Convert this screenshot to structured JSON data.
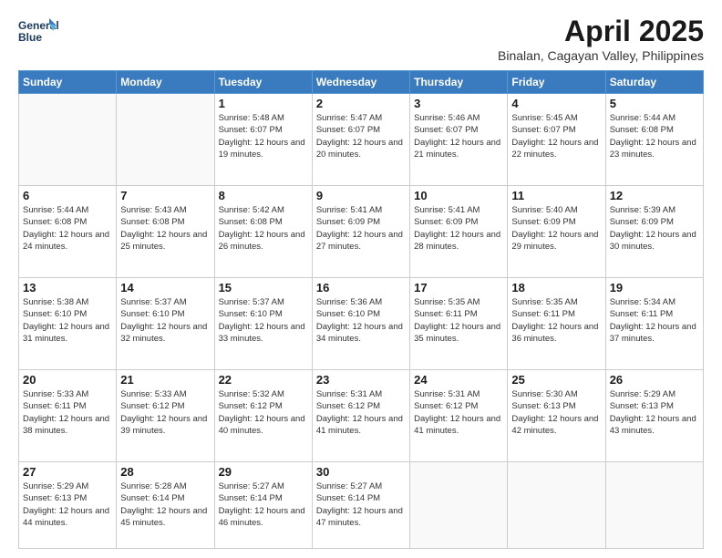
{
  "logo": {
    "line1": "General",
    "line2": "Blue"
  },
  "title": "April 2025",
  "subtitle": "Binalan, Cagayan Valley, Philippines",
  "days_of_week": [
    "Sunday",
    "Monday",
    "Tuesday",
    "Wednesday",
    "Thursday",
    "Friday",
    "Saturday"
  ],
  "weeks": [
    [
      {
        "day": "",
        "info": ""
      },
      {
        "day": "",
        "info": ""
      },
      {
        "day": "1",
        "sunrise": "Sunrise: 5:48 AM",
        "sunset": "Sunset: 6:07 PM",
        "daylight": "Daylight: 12 hours and 19 minutes."
      },
      {
        "day": "2",
        "sunrise": "Sunrise: 5:47 AM",
        "sunset": "Sunset: 6:07 PM",
        "daylight": "Daylight: 12 hours and 20 minutes."
      },
      {
        "day": "3",
        "sunrise": "Sunrise: 5:46 AM",
        "sunset": "Sunset: 6:07 PM",
        "daylight": "Daylight: 12 hours and 21 minutes."
      },
      {
        "day": "4",
        "sunrise": "Sunrise: 5:45 AM",
        "sunset": "Sunset: 6:07 PM",
        "daylight": "Daylight: 12 hours and 22 minutes."
      },
      {
        "day": "5",
        "sunrise": "Sunrise: 5:44 AM",
        "sunset": "Sunset: 6:08 PM",
        "daylight": "Daylight: 12 hours and 23 minutes."
      }
    ],
    [
      {
        "day": "6",
        "sunrise": "Sunrise: 5:44 AM",
        "sunset": "Sunset: 6:08 PM",
        "daylight": "Daylight: 12 hours and 24 minutes."
      },
      {
        "day": "7",
        "sunrise": "Sunrise: 5:43 AM",
        "sunset": "Sunset: 6:08 PM",
        "daylight": "Daylight: 12 hours and 25 minutes."
      },
      {
        "day": "8",
        "sunrise": "Sunrise: 5:42 AM",
        "sunset": "Sunset: 6:08 PM",
        "daylight": "Daylight: 12 hours and 26 minutes."
      },
      {
        "day": "9",
        "sunrise": "Sunrise: 5:41 AM",
        "sunset": "Sunset: 6:09 PM",
        "daylight": "Daylight: 12 hours and 27 minutes."
      },
      {
        "day": "10",
        "sunrise": "Sunrise: 5:41 AM",
        "sunset": "Sunset: 6:09 PM",
        "daylight": "Daylight: 12 hours and 28 minutes."
      },
      {
        "day": "11",
        "sunrise": "Sunrise: 5:40 AM",
        "sunset": "Sunset: 6:09 PM",
        "daylight": "Daylight: 12 hours and 29 minutes."
      },
      {
        "day": "12",
        "sunrise": "Sunrise: 5:39 AM",
        "sunset": "Sunset: 6:09 PM",
        "daylight": "Daylight: 12 hours and 30 minutes."
      }
    ],
    [
      {
        "day": "13",
        "sunrise": "Sunrise: 5:38 AM",
        "sunset": "Sunset: 6:10 PM",
        "daylight": "Daylight: 12 hours and 31 minutes."
      },
      {
        "day": "14",
        "sunrise": "Sunrise: 5:37 AM",
        "sunset": "Sunset: 6:10 PM",
        "daylight": "Daylight: 12 hours and 32 minutes."
      },
      {
        "day": "15",
        "sunrise": "Sunrise: 5:37 AM",
        "sunset": "Sunset: 6:10 PM",
        "daylight": "Daylight: 12 hours and 33 minutes."
      },
      {
        "day": "16",
        "sunrise": "Sunrise: 5:36 AM",
        "sunset": "Sunset: 6:10 PM",
        "daylight": "Daylight: 12 hours and 34 minutes."
      },
      {
        "day": "17",
        "sunrise": "Sunrise: 5:35 AM",
        "sunset": "Sunset: 6:11 PM",
        "daylight": "Daylight: 12 hours and 35 minutes."
      },
      {
        "day": "18",
        "sunrise": "Sunrise: 5:35 AM",
        "sunset": "Sunset: 6:11 PM",
        "daylight": "Daylight: 12 hours and 36 minutes."
      },
      {
        "day": "19",
        "sunrise": "Sunrise: 5:34 AM",
        "sunset": "Sunset: 6:11 PM",
        "daylight": "Daylight: 12 hours and 37 minutes."
      }
    ],
    [
      {
        "day": "20",
        "sunrise": "Sunrise: 5:33 AM",
        "sunset": "Sunset: 6:11 PM",
        "daylight": "Daylight: 12 hours and 38 minutes."
      },
      {
        "day": "21",
        "sunrise": "Sunrise: 5:33 AM",
        "sunset": "Sunset: 6:12 PM",
        "daylight": "Daylight: 12 hours and 39 minutes."
      },
      {
        "day": "22",
        "sunrise": "Sunrise: 5:32 AM",
        "sunset": "Sunset: 6:12 PM",
        "daylight": "Daylight: 12 hours and 40 minutes."
      },
      {
        "day": "23",
        "sunrise": "Sunrise: 5:31 AM",
        "sunset": "Sunset: 6:12 PM",
        "daylight": "Daylight: 12 hours and 41 minutes."
      },
      {
        "day": "24",
        "sunrise": "Sunrise: 5:31 AM",
        "sunset": "Sunset: 6:12 PM",
        "daylight": "Daylight: 12 hours and 41 minutes."
      },
      {
        "day": "25",
        "sunrise": "Sunrise: 5:30 AM",
        "sunset": "Sunset: 6:13 PM",
        "daylight": "Daylight: 12 hours and 42 minutes."
      },
      {
        "day": "26",
        "sunrise": "Sunrise: 5:29 AM",
        "sunset": "Sunset: 6:13 PM",
        "daylight": "Daylight: 12 hours and 43 minutes."
      }
    ],
    [
      {
        "day": "27",
        "sunrise": "Sunrise: 5:29 AM",
        "sunset": "Sunset: 6:13 PM",
        "daylight": "Daylight: 12 hours and 44 minutes."
      },
      {
        "day": "28",
        "sunrise": "Sunrise: 5:28 AM",
        "sunset": "Sunset: 6:14 PM",
        "daylight": "Daylight: 12 hours and 45 minutes."
      },
      {
        "day": "29",
        "sunrise": "Sunrise: 5:27 AM",
        "sunset": "Sunset: 6:14 PM",
        "daylight": "Daylight: 12 hours and 46 minutes."
      },
      {
        "day": "30",
        "sunrise": "Sunrise: 5:27 AM",
        "sunset": "Sunset: 6:14 PM",
        "daylight": "Daylight: 12 hours and 47 minutes."
      },
      {
        "day": "",
        "info": ""
      },
      {
        "day": "",
        "info": ""
      },
      {
        "day": "",
        "info": ""
      }
    ]
  ]
}
